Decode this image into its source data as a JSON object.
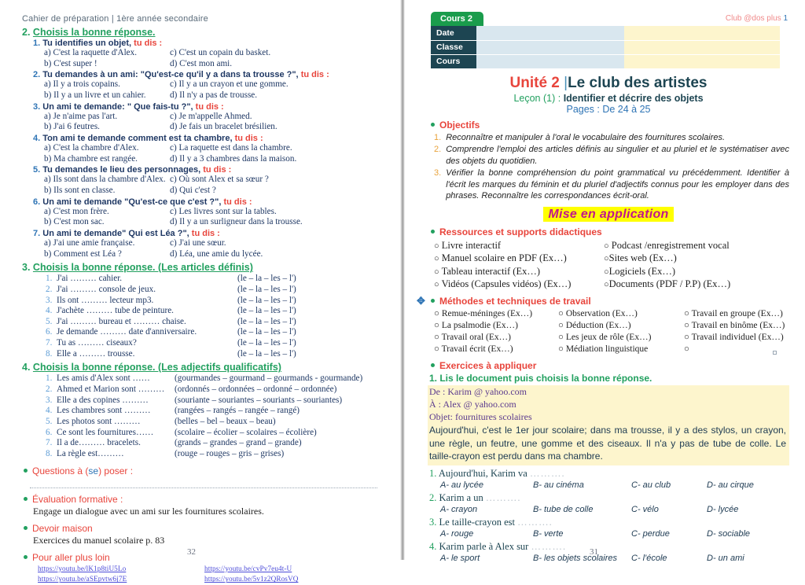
{
  "left_page": {
    "doc_header": "Cahier de préparation  |  1ère  année secondaire",
    "page_number": "32",
    "section2": {
      "num": "2.",
      "title": "Choisis la  bonne réponse.",
      "questions": [
        {
          "n": "1.",
          "prompt": "Tu identifies un objet,",
          "tudis": "tu dis :",
          "a": "a) C'est la raquette d'Alex.",
          "b": "b) C'est super !",
          "c": "c) C'est un copain du basket.",
          "d": "d) C'est mon ami."
        },
        {
          "n": "2.",
          "prompt": "Tu demandes à un ami: \"Qu'est-ce qu'il y a dans ta trousse ?\",",
          "tudis": "tu dis :",
          "a": "a) Il y a trois copains.",
          "b": "b) Il y a un livre et un cahier.",
          "c": "c) Il y a un crayon et  une gomme.",
          "d": "d) Il n'y a pas de trousse."
        },
        {
          "n": "3.",
          "prompt": "Un ami te demande: \" Que fais-tu ?\",",
          "tudis": "tu dis :",
          "a": "a) Je n'aime pas l'art.",
          "b": "b) J'ai 6 feutres.",
          "c": "c) Je m'appelle Ahmed.",
          "d": "d) Je fais un bracelet brésilien."
        },
        {
          "n": "4.",
          "prompt": "Ton ami te demande comment est ta chambre,",
          "tudis": "tu dis :",
          "a": "a) C'est la chambre d'Alex.",
          "b": "b) Ma chambre est rangée.",
          "c": "c) La raquette est dans la chambre.",
          "d": "d) Il y a 3 chambres dans la maison."
        },
        {
          "n": "5.",
          "prompt": "Tu demandes le lieu des personnages,",
          "tudis": "tu dis :",
          "a": "a) Ils sont dans la chambre d'Alex.",
          "b": "b) Ils sont en classe.",
          "c": "c) Où sont Alex et sa sœur ?",
          "d": "d) Qui c'est ?"
        },
        {
          "n": "6.",
          "prompt": "Un ami te demande \"Qu'est-ce que c'est ?\",",
          "tudis": "tu dis :",
          "a": "a) C'est mon frère.",
          "b": "b) C'est mon sac.",
          "c": "c) Les livres  sont sur la tables.",
          "d": "d) Il y a un surligneur dans la trousse."
        },
        {
          "n": "7.",
          "prompt": "Un ami te demande\" Qui est Léa ?\",",
          "tudis": "tu dis :",
          "a": "a) J'ai une amie française.",
          "b": "b) Comment est Léa ?",
          "c": "c) J'ai une sœur.",
          "d": "d) Léa, une amie du lycée."
        }
      ]
    },
    "section3": {
      "num": "3.",
      "title": "Choisis la  bonne réponse. (Les articles définis)",
      "items": [
        {
          "n": "1.",
          "text": "J'ai ………  cahier.",
          "choices": "(le – la – les – l')"
        },
        {
          "n": "2.",
          "text": "J'ai ……… console de jeux.",
          "choices": "(le – la – les – l')"
        },
        {
          "n": "3.",
          "text": "Ils ont ……… lecteur mp3.",
          "choices": "(le – la – les – l')"
        },
        {
          "n": "4.",
          "text": "J'achète ……… tube de peinture.",
          "choices": "(le – la – les – l')"
        },
        {
          "n": "5.",
          "text": "J'ai ……… bureau et ……… chaise.",
          "choices": "(le – la – les – l')"
        },
        {
          "n": "6.",
          "text": "Je demande ……… date d'anniversaire.",
          "choices": "(le – la – les – l')"
        },
        {
          "n": "7.",
          "text": "Tu as ……… ciseaux?",
          "choices": "(le – la – les – l')"
        },
        {
          "n": "8.",
          "text": "Elle a ……… trousse.",
          "choices": "(le – la – les – l')"
        }
      ]
    },
    "section4": {
      "num": "4.",
      "title": "Choisis la bonne réponse. (Les adjectifs qualificatifs)",
      "items": [
        {
          "n": "1.",
          "text": "Les amis d'Alex sont ……",
          "choices": "(gourmandes – gourmand – gourmands - gourmande)"
        },
        {
          "n": "2.",
          "text": "Ahmed et Marion sont ………",
          "choices": "(ordonnés – ordonnées – ordonné – ordonnée)"
        },
        {
          "n": "3.",
          "text": "Elle a des copines ………",
          "choices": "(souriante – souriantes – souriants – souriantes)"
        },
        {
          "n": "4.",
          "text": "Les chambres sont ………",
          "choices": "(rangées – rangés – rangée – rangé)"
        },
        {
          "n": "5.",
          "text": "Les photos sont ………",
          "choices": "(belles – bel – beaux – beau)"
        },
        {
          "n": "6.",
          "text": "Ce sont les fournitures……",
          "choices": "(scolaire – écolier – scolaires – écolière)"
        },
        {
          "n": "7.",
          "text": "Il a de……… bracelets.",
          "choices": "(grands – grandes – grand – grande)"
        },
        {
          "n": "8.",
          "text": "La règle est………",
          "choices": "(rouge – rouges – gris – grises)"
        }
      ]
    },
    "questions_a_poser": {
      "pre": "Questions à (",
      "mid": "se",
      "post": ") poser :"
    },
    "evaluation": {
      "title": "Évaluation formative :",
      "text": "Engage un dialogue avec un ami sur les fournitures scolaires."
    },
    "devoir": {
      "title": "Devoir maison",
      "text": "Exercices du manuel scolaire p. 83"
    },
    "pour_aller_plus_loin": {
      "title": "Pour aller plus loin",
      "links_col1": [
        "https://youtu.be/lK1p8tiU5Lo",
        "https://youtu.be/aSEpvtw6j7E"
      ],
      "links_col2": [
        "https://youtu.be/cvPv7eu4t-U",
        "https://youtu.be/5v1z2QRosVQ"
      ]
    }
  },
  "right_page": {
    "page_number": "31",
    "club_label": "Club @dos plus ",
    "club_number": "1",
    "cours_badge": "Cours 2",
    "info_rows": [
      {
        "label": "Date"
      },
      {
        "label": "Classe"
      },
      {
        "label": "Cours"
      }
    ],
    "unite": {
      "part1": "Unité 2 ",
      "bar": "|",
      "part2": "Le club des artistes"
    },
    "lecon": {
      "part1": "Leçon (1) : ",
      "part2": "Identifier et décrire des objets"
    },
    "pages": "Pages : De 24 à 25",
    "objectifs_title": "Objectifs",
    "objectifs": [
      {
        "n": "1.",
        "text": "Reconnaître et manipuler à l'oral le vocabulaire des fournitures scolaires."
      },
      {
        "n": "2.",
        "text": "Comprendre l'emploi des articles définis au singulier et au pluriel et le systématiser avec des objets du quotidien."
      },
      {
        "n": "3.",
        "text": "Vérifier la bonne compréhension du point grammatical vu précédemment. Identifier à l'écrit les marques du féminin et du pluriel d'adjectifs connus pour les employer dans des  phrases. Reconnaître les correspondances écrit-oral."
      }
    ],
    "mise_en_application": "Mise en application",
    "ressources_title": "Ressources et supports didactiques",
    "ressources_col1": [
      "Livre interactif",
      "Manuel scolaire en  PDF (Ex…)",
      "Tableau interactif (Ex…)",
      "Vidéos (Capsules vidéos) (Ex…)"
    ],
    "ressources_col2": [
      "Podcast /enregistrement vocal",
      "Sites web (Ex…)",
      "Logiciels (Ex…)",
      "Documents (PDF / P.P) (Ex…)"
    ],
    "methodes_title": "Méthodes et techniques de travail",
    "methodes_col1": [
      "Remue-méninges (Ex…)",
      "La psalmodie (Ex…)",
      "Travail oral (Ex…)",
      "Travail écrit (Ex…)"
    ],
    "methodes_col2": [
      "Observation (Ex…)",
      "Déduction (Ex…)",
      "Les jeux de rôle (Ex…)",
      "Médiation linguistique"
    ],
    "methodes_col3": [
      "Travail en groupe (Ex…)",
      "Travail en binôme (Ex…)",
      "Travail individuel (Ex…)",
      ""
    ],
    "exercices_title": "Exercices à appliquer",
    "exercice1_title": "1. Lis le document puis choisis la  bonne réponse.",
    "mail": {
      "from": "De : Karim @ yahoo.com",
      "to": "À : Alex @ yahoo.com",
      "subject": "Objet: fournitures scolaires",
      "body": "Aujourd'hui, c'est le 1er  jour scolaire; dans ma trousse, il y a des stylos, un crayon, une règle, un feutre, une gomme et des ciseaux. Il n'a y pas de tube de colle. Le taille-crayon est perdu dans ma chambre."
    },
    "mcq": [
      {
        "n": "1.",
        "question": "Aujourd'hui, Karim va",
        "dots": "……….",
        "a": "A- au lycée",
        "b": "B- au cinéma",
        "c": "C- au club",
        "d": "D- au cirque"
      },
      {
        "n": "2.",
        "question": "Karim a un",
        "dots": "……….",
        "a": "A- crayon",
        "b": "B- tube de colle",
        "c": "C-  vélo",
        "d": "D-  lycée"
      },
      {
        "n": "3.",
        "question": "Le taille-crayon est",
        "dots": "……….",
        "a": "A- rouge",
        "b": "B- verte",
        "c": "C-  perdue",
        "d": "D-  sociable"
      },
      {
        "n": "4.",
        "question": "Karim parle à Alex sur",
        "dots": "……….",
        "a": "A- le sport",
        "b": "B- les objets scolaires",
        "c": "C-  l'école",
        "d": "D-  un ami"
      }
    ]
  },
  "colors": {
    "green": "#22a05f",
    "badge_green": "#1a9c4c",
    "dark_teal": "#1d4552",
    "red": "#e8453c",
    "navy": "#1f3864",
    "blue": "#2e74b5",
    "highlight_yellow": "#ffff00",
    "mail_yellow": "#fdf5cd",
    "cell_blue": "#d9e7ef",
    "magenta": "#c0168c",
    "link_blue": "#4a4ad8"
  }
}
